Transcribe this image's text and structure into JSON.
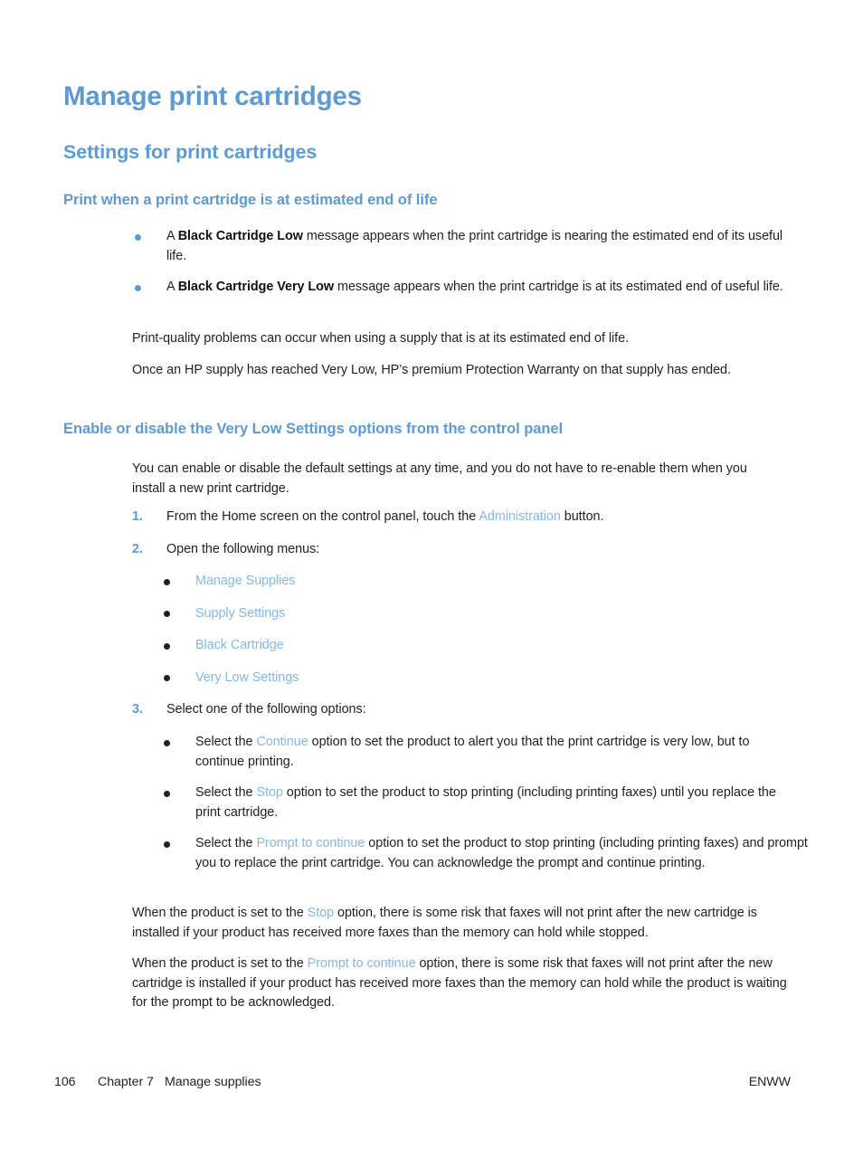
{
  "document": {
    "title": "Manage print cartridges",
    "section_heading": "Settings for print cartridges"
  },
  "section_1": {
    "heading": "Print when a print cartridge is at estimated end of life",
    "bullets": [
      {
        "prefix": "A ",
        "bold": "Black Cartridge Low",
        "suffix": " message appears when the print cartridge is nearing the estimated end of its useful life."
      },
      {
        "prefix": "A ",
        "bold": "Black Cartridge Very Low",
        "suffix": " message appears when the print cartridge is at its estimated end of useful life."
      }
    ],
    "paragraph_1": "Print-quality problems can occur when using a supply that is at its estimated end of life.",
    "paragraph_2": "Once an HP supply has reached Very Low, HP’s premium Protection Warranty on that supply has ended."
  },
  "section_2": {
    "heading": "Enable or disable the Very Low Settings options from the control panel",
    "intro": "You can enable or disable the default settings at any time, and you do not have to re-enable them when you install a new print cartridge.",
    "steps": [
      {
        "number": "1.",
        "text_before": "From the Home screen on the control panel, touch the ",
        "link": "Administration",
        "text_after": " button."
      },
      {
        "number": "2.",
        "text_before": "Open the following menus:",
        "link": "",
        "text_after": ""
      },
      {
        "number": "3.",
        "text_before": "Select one of the following options:",
        "link": "",
        "text_after": ""
      }
    ],
    "menu_items": [
      "Manage Supplies",
      "Supply Settings",
      "Black Cartridge",
      "Very Low Settings"
    ],
    "options": [
      {
        "text_before": "Select the ",
        "link": "Continue",
        "text_after": " option to set the product to alert you that the print cartridge is very low, but to continue printing."
      },
      {
        "text_before": "Select the ",
        "link": "Stop",
        "text_after": " option to set the product to stop printing (including printing faxes) until you replace the print cartridge."
      },
      {
        "text_before": "Select the ",
        "link": "Prompt to continue",
        "text_after": " option to set the product to stop printing (including printing faxes) and prompt you to replace the print cartridge. You can acknowledge the prompt and continue printing."
      }
    ],
    "notes": [
      {
        "text_before": "When the product is set to the ",
        "link": "Stop",
        "text_after": " option, there is some risk that faxes will not print after the new cartridge is installed if your product has received more faxes than the memory can hold while stopped."
      },
      {
        "text_before": "When the product is set to the ",
        "link": "Prompt to continue",
        "text_after": " option, there is some risk that faxes will not print after the new cartridge is installed if your product has received more faxes than the memory can hold while the product is waiting for the prompt to be acknowledged."
      }
    ]
  },
  "footer": {
    "page_number": "106",
    "chapter": "Chapter 7",
    "chapter_title": "Manage supplies",
    "locale": "ENWW"
  },
  "colors": {
    "heading_blue": "#5b9bd5",
    "link_blue": "#82b8e6",
    "body_text": "#231f20"
  }
}
